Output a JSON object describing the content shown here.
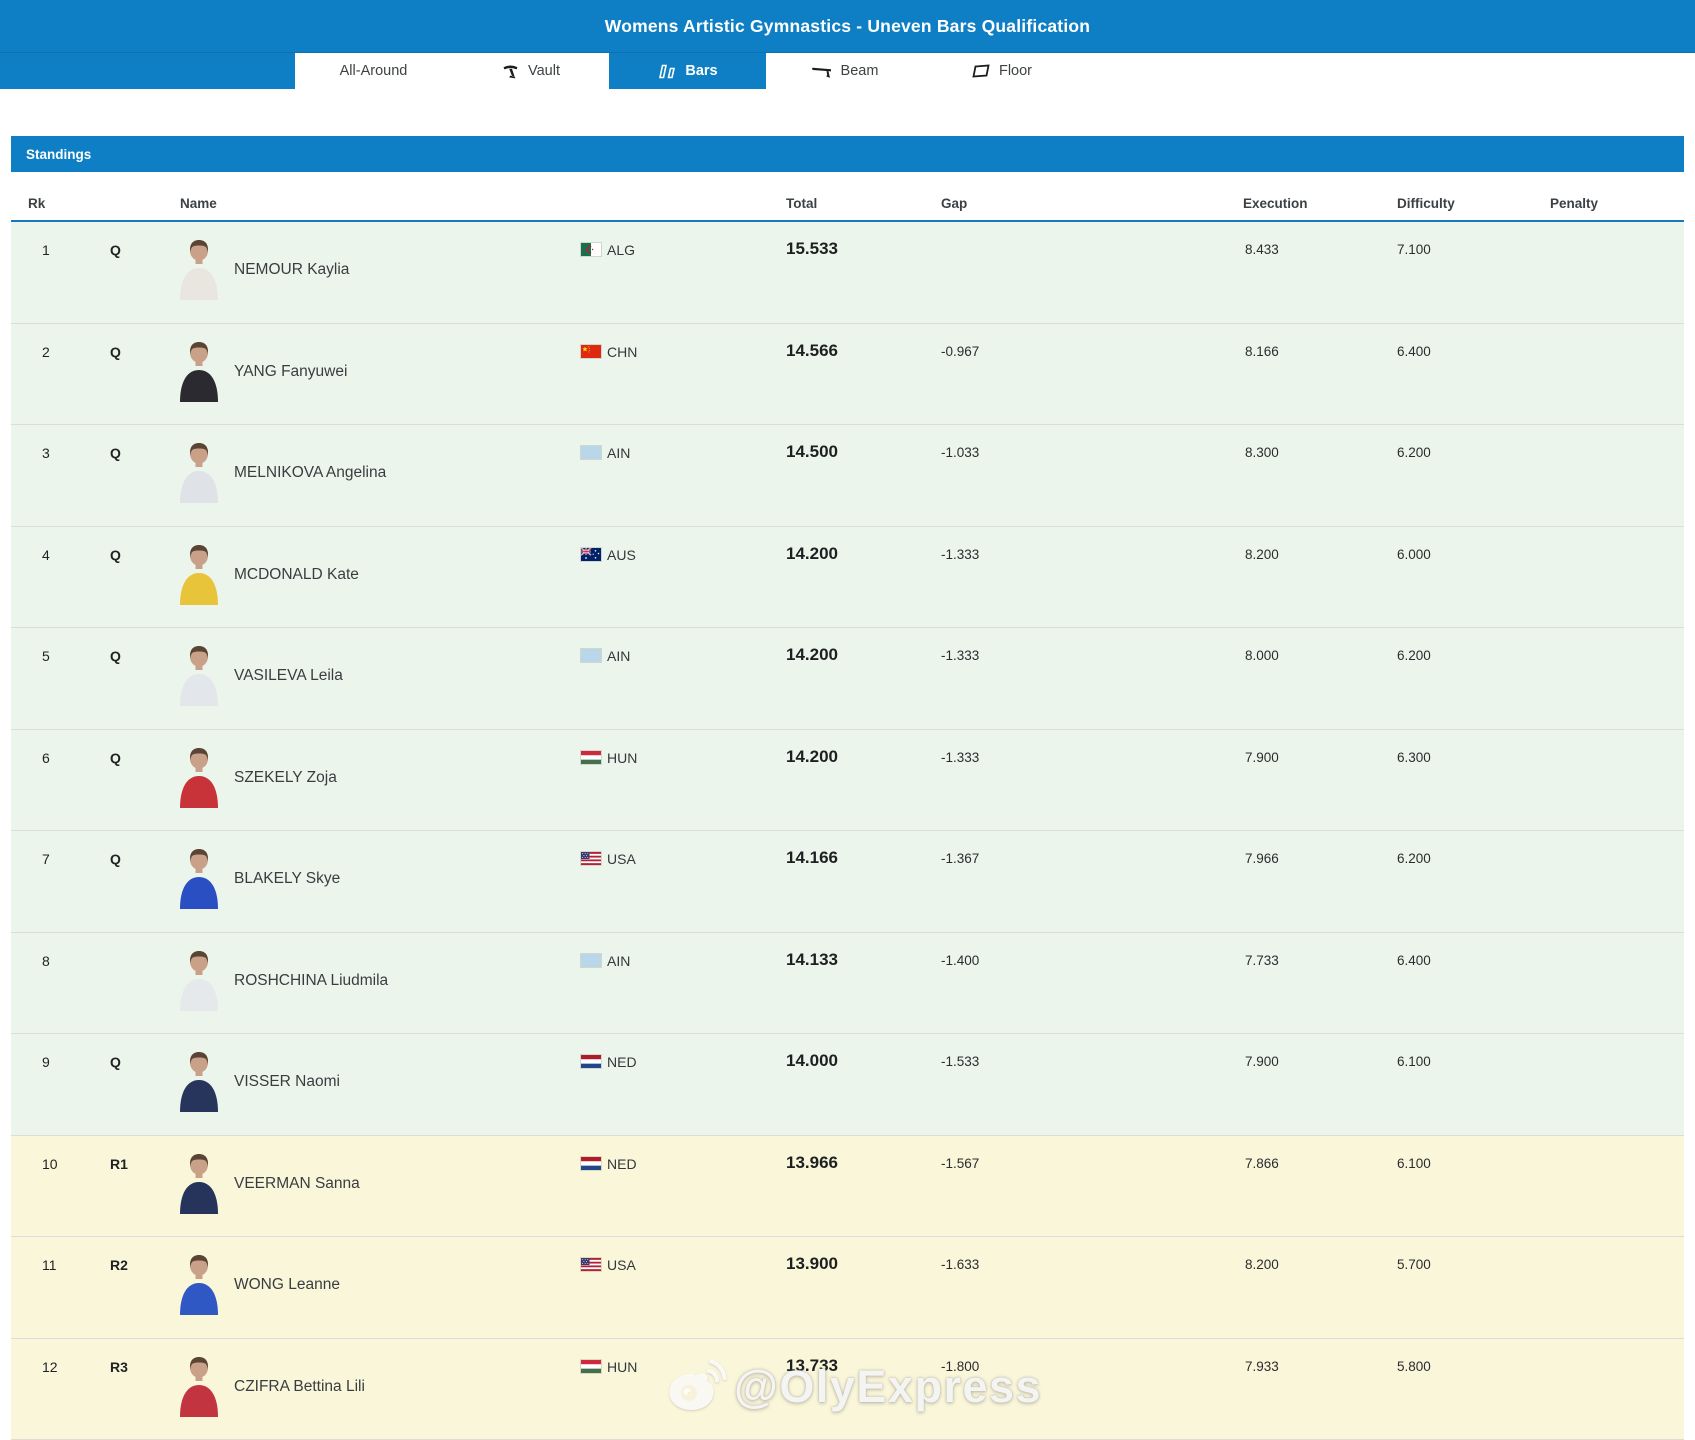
{
  "header": {
    "title": "Womens Artistic Gymnastics - Uneven Bars Qualification"
  },
  "tabs": [
    {
      "label": "All-Around",
      "icon": null,
      "active": false
    },
    {
      "label": "Vault",
      "icon": "vault-icon",
      "active": false
    },
    {
      "label": "Bars",
      "icon": "bars-icon",
      "active": true
    },
    {
      "label": "Beam",
      "icon": "beam-icon",
      "active": false
    },
    {
      "label": "Floor",
      "icon": "floor-icon",
      "active": false
    }
  ],
  "standings": {
    "label": "Standings"
  },
  "columns": {
    "rk": "Rk",
    "name": "Name",
    "total": "Total",
    "gap": "Gap",
    "execution": "Execution",
    "difficulty": "Difficulty",
    "penalty": "Penalty"
  },
  "rows": [
    {
      "rank": "1",
      "qual": "Q",
      "name": "NEMOUR Kaylia",
      "country": "ALG",
      "total": "15.533",
      "gap": "",
      "execution": "8.433",
      "difficulty": "7.100",
      "penalty": "",
      "jersey": "#e8e6df"
    },
    {
      "rank": "2",
      "qual": "Q",
      "name": "YANG Fanyuwei",
      "country": "CHN",
      "total": "14.566",
      "gap": "-0.967",
      "execution": "8.166",
      "difficulty": "6.400",
      "penalty": "",
      "jersey": "#2a2a30"
    },
    {
      "rank": "3",
      "qual": "Q",
      "name": "MELNIKOVA Angelina",
      "country": "AIN",
      "total": "14.500",
      "gap": "-1.033",
      "execution": "8.300",
      "difficulty": "6.200",
      "penalty": "",
      "jersey": "#dfe3e8"
    },
    {
      "rank": "4",
      "qual": "Q",
      "name": "MCDONALD Kate",
      "country": "AUS",
      "total": "14.200",
      "gap": "-1.333",
      "execution": "8.200",
      "difficulty": "6.000",
      "penalty": "",
      "jersey": "#e8c43a"
    },
    {
      "rank": "5",
      "qual": "Q",
      "name": "VASILEVA Leila",
      "country": "AIN",
      "total": "14.200",
      "gap": "-1.333",
      "execution": "8.000",
      "difficulty": "6.200",
      "penalty": "",
      "jersey": "#e3e6ea"
    },
    {
      "rank": "6",
      "qual": "Q",
      "name": "SZEKELY Zoja",
      "country": "HUN",
      "total": "14.200",
      "gap": "-1.333",
      "execution": "7.900",
      "difficulty": "6.300",
      "penalty": "",
      "jersey": "#c8333a"
    },
    {
      "rank": "7",
      "qual": "Q",
      "name": "BLAKELY Skye",
      "country": "USA",
      "total": "14.166",
      "gap": "-1.367",
      "execution": "7.966",
      "difficulty": "6.200",
      "penalty": "",
      "jersey": "#2a4fc2"
    },
    {
      "rank": "8",
      "qual": "",
      "name": "ROSHCHINA Liudmila",
      "country": "AIN",
      "total": "14.133",
      "gap": "-1.400",
      "execution": "7.733",
      "difficulty": "6.400",
      "penalty": "",
      "jersey": "#e6e9ec"
    },
    {
      "rank": "9",
      "qual": "Q",
      "name": "VISSER Naomi",
      "country": "NED",
      "total": "14.000",
      "gap": "-1.533",
      "execution": "7.900",
      "difficulty": "6.100",
      "penalty": "",
      "jersey": "#27355c"
    },
    {
      "rank": "10",
      "qual": "R1",
      "name": "VEERMAN Sanna",
      "country": "NED",
      "total": "13.966",
      "gap": "-1.567",
      "execution": "7.866",
      "difficulty": "6.100",
      "penalty": "",
      "jersey": "#26335a"
    },
    {
      "rank": "11",
      "qual": "R2",
      "name": "WONG Leanne",
      "country": "USA",
      "total": "13.900",
      "gap": "-1.633",
      "execution": "8.200",
      "difficulty": "5.700",
      "penalty": "",
      "jersey": "#2f58c4"
    },
    {
      "rank": "12",
      "qual": "R3",
      "name": "CZIFRA Bettina Lili",
      "country": "HUN",
      "total": "13.733",
      "gap": "-1.800",
      "execution": "7.933",
      "difficulty": "5.800",
      "penalty": "",
      "jersey": "#c23540"
    }
  ],
  "watermark": {
    "handle": "@OlyExpress",
    "logo": "weibo-icon"
  },
  "colors": {
    "accent_blue": "#0e7fc4",
    "qualified_row_bg": "#ecf5ec",
    "reserve_row_bg": "#faf6da",
    "header_rule_blue": "#1778bd"
  }
}
